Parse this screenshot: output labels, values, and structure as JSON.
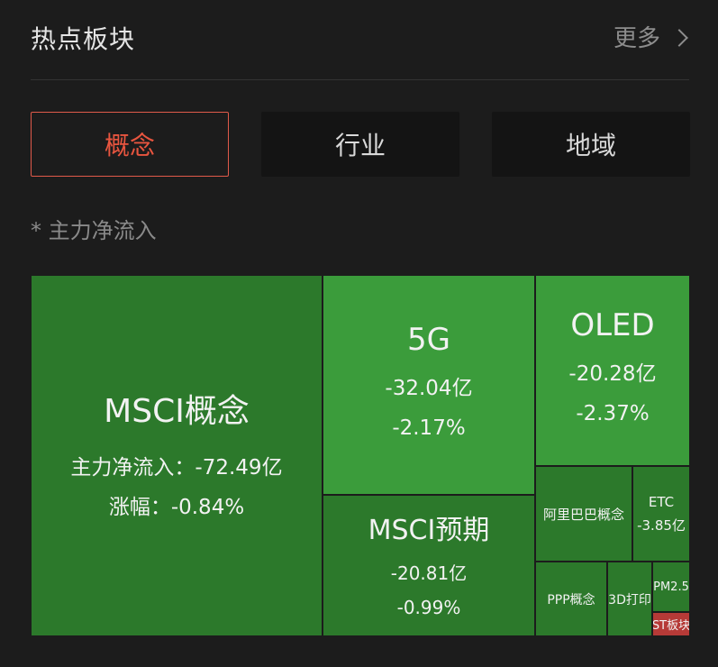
{
  "header": {
    "title": "热点板块",
    "more_label": "更多"
  },
  "tabs": [
    {
      "label": "概念",
      "active": true
    },
    {
      "label": "行业",
      "active": false
    },
    {
      "label": "地域",
      "active": false
    }
  ],
  "note": "* 主力净流入",
  "treemap": {
    "cells": {
      "msci_concept": {
        "name": "MSCI概念",
        "inflow_line": "主力净流入：-72.49亿",
        "change_line": "涨幅：-0.84%"
      },
      "fiveg": {
        "name": "5G",
        "inflow": "-32.04亿",
        "change": "-2.17%"
      },
      "oled": {
        "name": "OLED",
        "inflow": "-20.28亿",
        "change": "-2.37%"
      },
      "msci_forecast": {
        "name": "MSCI预期",
        "inflow": "-20.81亿",
        "change": "-0.99%"
      },
      "alibaba": {
        "name": "阿里巴巴概念"
      },
      "etc": {
        "name": "ETC",
        "inflow": "-3.85亿"
      },
      "ppp": {
        "name": "PPP概念"
      },
      "print3d": {
        "name": "3D打印"
      },
      "pm25": {
        "name": "PM2.5"
      },
      "st": {
        "name": "ST板块"
      }
    }
  },
  "colors": {
    "background": "#1c1c1c",
    "accent": "#e8553f",
    "green_dark": "#2c792b",
    "green_light": "#3b9c3b",
    "red": "#b63a37"
  },
  "icons": {
    "more": "chevron-right-icon"
  }
}
